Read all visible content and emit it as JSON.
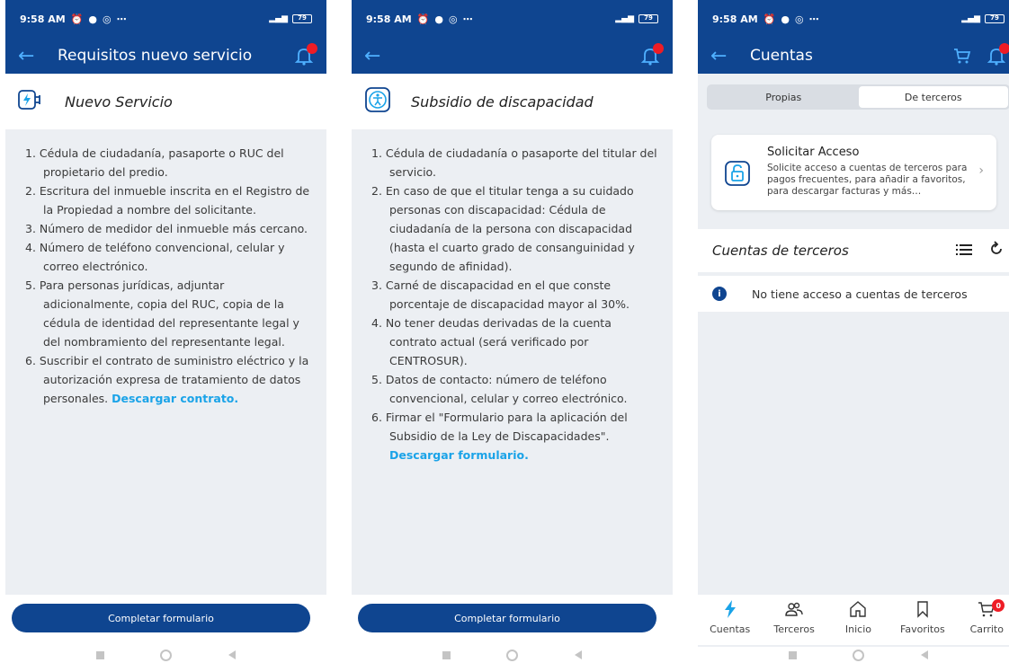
{
  "status": {
    "time": "9:58 AM",
    "battery": "79",
    "net": "LTE"
  },
  "screen1": {
    "title": "Requisitos nuevo servicio",
    "heading": "Nuevo Servicio",
    "items": [
      "1. Cédula de ciudadanía, pasaporte o RUC del propietario del predio.",
      "2. Escritura del inmueble inscrita en el Registro de la Propiedad a nombre del solicitante.",
      "3. Número de medidor del inmueble más cercano.",
      "4. Número de teléfono convencional, celular y correo electrónico.",
      "5. Para personas jurídicas, adjuntar adicionalmente, copia del RUC, copia de la cédula de identidad del representante legal y del nombramiento del representante legal."
    ],
    "item6_text": "6.  Suscribir el contrato de suministro eléctrico y la autorización expresa de tratamiento de datos personales.",
    "item6_link": "Descargar contrato.",
    "button": "Completar formulario"
  },
  "screen2": {
    "heading": "Subsidio de discapacidad",
    "items": [
      "1. Cédula de ciudadanía o pasaporte del titular del servicio.",
      "2. En caso de que el titular tenga a su cuidado personas con discapacidad: Cédula de ciudadanía de la persona con discapacidad (hasta el cuarto grado de consanguinidad y segundo de afinidad).",
      "3. Carné de discapacidad en el que conste porcentaje de discapacidad mayor al 30%.",
      "4. No tener deudas derivadas de la cuenta contrato actual (será verificado por CENTROSUR).",
      "5. Datos de contacto: número de teléfono convencional, celular y correo electrónico."
    ],
    "item6_text": "6. Firmar el \"Formulario para la aplicación del Subsidio de la Ley de Discapacidades\".",
    "item6_link": "Descargar formulario.",
    "button": "Completar formulario"
  },
  "screen3": {
    "title": "Cuentas",
    "seg_left": "Propias",
    "seg_right": "De terceros",
    "access_title": "Solicitar Acceso",
    "access_desc": "Solicite acceso a cuentas de terceros para pagos frecuentes, para añadir a favoritos, para descargar facturas y más…",
    "section_title": "Cuentas de terceros",
    "empty_msg": "No tiene acceso a cuentas de terceros",
    "tabs": [
      "Cuentas",
      "Terceros",
      "Inicio",
      "Favoritos",
      "Carrito"
    ],
    "cart_count": "0",
    "colors": {
      "brand": "#0f4590",
      "accent": "#1aa3e8",
      "alert": "#ee1c25"
    }
  }
}
